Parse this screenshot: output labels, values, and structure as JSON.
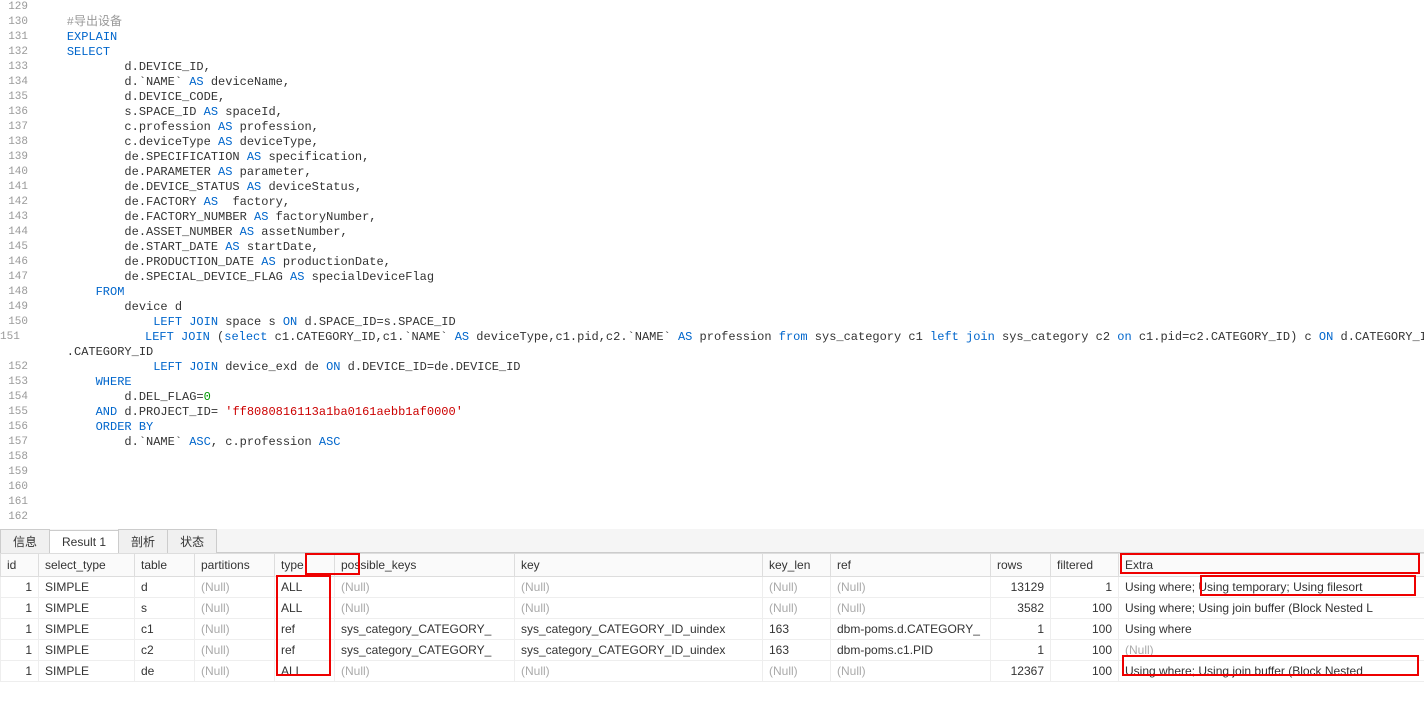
{
  "editor": {
    "lines": [
      {
        "n": 129,
        "segs": []
      },
      {
        "n": 130,
        "segs": [
          {
            "t": "    #导出设备",
            "c": "cmt"
          }
        ]
      },
      {
        "n": 131,
        "segs": [
          {
            "t": "    ",
            "c": ""
          },
          {
            "t": "EXPLAIN",
            "c": "kw"
          }
        ]
      },
      {
        "n": 132,
        "segs": [
          {
            "t": "    ",
            "c": ""
          },
          {
            "t": "SELECT",
            "c": "kw"
          }
        ]
      },
      {
        "n": 133,
        "segs": [
          {
            "t": "            d.DEVICE_ID,",
            "c": ""
          }
        ]
      },
      {
        "n": 134,
        "segs": [
          {
            "t": "            d.`NAME` ",
            "c": ""
          },
          {
            "t": "AS",
            "c": "kw"
          },
          {
            "t": " deviceName,",
            "c": ""
          }
        ]
      },
      {
        "n": 135,
        "segs": [
          {
            "t": "            d.DEVICE_CODE,",
            "c": ""
          }
        ]
      },
      {
        "n": 136,
        "segs": [
          {
            "t": "            s.SPACE_ID ",
            "c": ""
          },
          {
            "t": "AS",
            "c": "kw"
          },
          {
            "t": " spaceId,",
            "c": ""
          }
        ]
      },
      {
        "n": 137,
        "segs": [
          {
            "t": "            c.profession ",
            "c": ""
          },
          {
            "t": "AS",
            "c": "kw"
          },
          {
            "t": " profession,",
            "c": ""
          }
        ]
      },
      {
        "n": 138,
        "segs": [
          {
            "t": "            c.deviceType ",
            "c": ""
          },
          {
            "t": "AS",
            "c": "kw"
          },
          {
            "t": " deviceType,",
            "c": ""
          }
        ]
      },
      {
        "n": 139,
        "segs": [
          {
            "t": "            de.SPECIFICATION ",
            "c": ""
          },
          {
            "t": "AS",
            "c": "kw"
          },
          {
            "t": " specification,",
            "c": ""
          }
        ]
      },
      {
        "n": 140,
        "segs": [
          {
            "t": "            de.PARAMETER ",
            "c": ""
          },
          {
            "t": "AS",
            "c": "kw"
          },
          {
            "t": " parameter,",
            "c": ""
          }
        ]
      },
      {
        "n": 141,
        "segs": [
          {
            "t": "            de.DEVICE_STATUS ",
            "c": ""
          },
          {
            "t": "AS",
            "c": "kw"
          },
          {
            "t": " deviceStatus,",
            "c": ""
          }
        ]
      },
      {
        "n": 142,
        "segs": [
          {
            "t": "            de.FACTORY ",
            "c": ""
          },
          {
            "t": "AS",
            "c": "kw"
          },
          {
            "t": "  factory,",
            "c": ""
          }
        ]
      },
      {
        "n": 143,
        "segs": [
          {
            "t": "            de.FACTORY_NUMBER ",
            "c": ""
          },
          {
            "t": "AS",
            "c": "kw"
          },
          {
            "t": " factoryNumber,",
            "c": ""
          }
        ]
      },
      {
        "n": 144,
        "segs": [
          {
            "t": "            de.ASSET_NUMBER ",
            "c": ""
          },
          {
            "t": "AS",
            "c": "kw"
          },
          {
            "t": " assetNumber,",
            "c": ""
          }
        ]
      },
      {
        "n": 145,
        "segs": [
          {
            "t": "            de.START_DATE ",
            "c": ""
          },
          {
            "t": "AS",
            "c": "kw"
          },
          {
            "t": " startDate,",
            "c": ""
          }
        ]
      },
      {
        "n": 146,
        "segs": [
          {
            "t": "            de.PRODUCTION_DATE ",
            "c": ""
          },
          {
            "t": "AS",
            "c": "kw"
          },
          {
            "t": " productionDate,",
            "c": ""
          }
        ]
      },
      {
        "n": 147,
        "segs": [
          {
            "t": "            de.SPECIAL_DEVICE_FLAG ",
            "c": ""
          },
          {
            "t": "AS",
            "c": "kw"
          },
          {
            "t": " specialDeviceFlag",
            "c": ""
          }
        ]
      },
      {
        "n": 148,
        "segs": [
          {
            "t": "        ",
            "c": ""
          },
          {
            "t": "FROM",
            "c": "kw"
          }
        ]
      },
      {
        "n": 149,
        "segs": [
          {
            "t": "            device d",
            "c": ""
          }
        ]
      },
      {
        "n": 150,
        "segs": [
          {
            "t": "                ",
            "c": ""
          },
          {
            "t": "LEFT JOIN",
            "c": "kw"
          },
          {
            "t": " space s ",
            "c": ""
          },
          {
            "t": "ON",
            "c": "kw"
          },
          {
            "t": " d.SPACE_ID=s.SPACE_ID",
            "c": ""
          }
        ]
      },
      {
        "n": 151,
        "segs": [
          {
            "t": "                ",
            "c": ""
          },
          {
            "t": "LEFT JOIN",
            "c": "kw"
          },
          {
            "t": " (",
            "c": ""
          },
          {
            "t": "select",
            "c": "kw"
          },
          {
            "t": " c1.CATEGORY_ID,c1.`NAME` ",
            "c": ""
          },
          {
            "t": "AS",
            "c": "kw"
          },
          {
            "t": " deviceType,c1.pid,c2.`NAME` ",
            "c": ""
          },
          {
            "t": "AS",
            "c": "kw"
          },
          {
            "t": " profession ",
            "c": ""
          },
          {
            "t": "from",
            "c": "kw"
          },
          {
            "t": " sys_category c1 ",
            "c": ""
          },
          {
            "t": "left join",
            "c": "kw"
          },
          {
            "t": " sys_category c2 ",
            "c": ""
          },
          {
            "t": "on",
            "c": "kw"
          },
          {
            "t": " c1.pid=c2.CATEGORY_ID) c ",
            "c": ""
          },
          {
            "t": "ON",
            "c": "kw"
          },
          {
            "t": " d.CATEGORY_ID=c",
            "c": ""
          }
        ]
      },
      {
        "n": "",
        "segs": [
          {
            "t": "    .CATEGORY_ID",
            "c": ""
          }
        ]
      },
      {
        "n": 152,
        "segs": [
          {
            "t": "                ",
            "c": ""
          },
          {
            "t": "LEFT JOIN",
            "c": "kw"
          },
          {
            "t": " device_exd de ",
            "c": ""
          },
          {
            "t": "ON",
            "c": "kw"
          },
          {
            "t": " d.DEVICE_ID=de.DEVICE_ID",
            "c": ""
          }
        ]
      },
      {
        "n": 153,
        "segs": [
          {
            "t": "        ",
            "c": ""
          },
          {
            "t": "WHERE",
            "c": "kw"
          }
        ]
      },
      {
        "n": 154,
        "segs": [
          {
            "t": "            d.DEL_FLAG=",
            "c": ""
          },
          {
            "t": "0",
            "c": "num"
          }
        ]
      },
      {
        "n": 155,
        "segs": [
          {
            "t": "        ",
            "c": ""
          },
          {
            "t": "AND",
            "c": "kw"
          },
          {
            "t": " d.PROJECT_ID= ",
            "c": ""
          },
          {
            "t": "'ff8080816113a1ba0161aebb1af0000'",
            "c": "str"
          }
        ]
      },
      {
        "n": 156,
        "segs": [
          {
            "t": "        ",
            "c": ""
          },
          {
            "t": "ORDER BY",
            "c": "kw"
          }
        ]
      },
      {
        "n": 157,
        "segs": [
          {
            "t": "            d.`NAME` ",
            "c": ""
          },
          {
            "t": "ASC",
            "c": "kw"
          },
          {
            "t": ", c.profession ",
            "c": ""
          },
          {
            "t": "ASC",
            "c": "kw"
          }
        ]
      },
      {
        "n": 158,
        "segs": []
      },
      {
        "n": 159,
        "segs": []
      },
      {
        "n": 160,
        "segs": []
      },
      {
        "n": 161,
        "segs": []
      },
      {
        "n": 162,
        "segs": []
      }
    ]
  },
  "tabs": {
    "info": "信息",
    "result": "Result 1",
    "profile": "剖析",
    "status": "状态"
  },
  "table": {
    "headers": [
      "id",
      "select_type",
      "table",
      "partitions",
      "type",
      "possible_keys",
      "key",
      "key_len",
      "ref",
      "rows",
      "filtered",
      "Extra"
    ],
    "widths": [
      38,
      96,
      60,
      80,
      60,
      180,
      248,
      68,
      160,
      60,
      68,
      306
    ],
    "aligns": [
      "right",
      "left",
      "left",
      "left",
      "left",
      "left",
      "left",
      "left",
      "left",
      "right",
      "right",
      "left"
    ],
    "rows": [
      {
        "cells": [
          "1",
          "SIMPLE",
          "d",
          "(Null)",
          "ALL",
          "(Null)",
          "(Null)",
          "(Null)",
          "(Null)",
          "13129",
          "1",
          "Using where; Using temporary; Using filesort"
        ]
      },
      {
        "cells": [
          "1",
          "SIMPLE",
          "s",
          "(Null)",
          "ALL",
          "(Null)",
          "(Null)",
          "(Null)",
          "(Null)",
          "3582",
          "100",
          "Using where; Using join buffer (Block Nested L"
        ]
      },
      {
        "cells": [
          "1",
          "SIMPLE",
          "c1",
          "(Null)",
          "ref",
          "sys_category_CATEGORY_",
          "sys_category_CATEGORY_ID_uindex",
          "163",
          "dbm-poms.d.CATEGORY_",
          "1",
          "100",
          "Using where"
        ]
      },
      {
        "cells": [
          "1",
          "SIMPLE",
          "c2",
          "(Null)",
          "ref",
          "sys_category_CATEGORY_",
          "sys_category_CATEGORY_ID_uindex",
          "163",
          "dbm-poms.c1.PID",
          "1",
          "100",
          "(Null)"
        ]
      },
      {
        "cells": [
          "1",
          "SIMPLE",
          "de",
          "(Null)",
          "ALL",
          "(Null)",
          "(Null)",
          "(Null)",
          "(Null)",
          "12367",
          "100",
          "Using where; Using join buffer  (Block Nested"
        ]
      }
    ]
  }
}
